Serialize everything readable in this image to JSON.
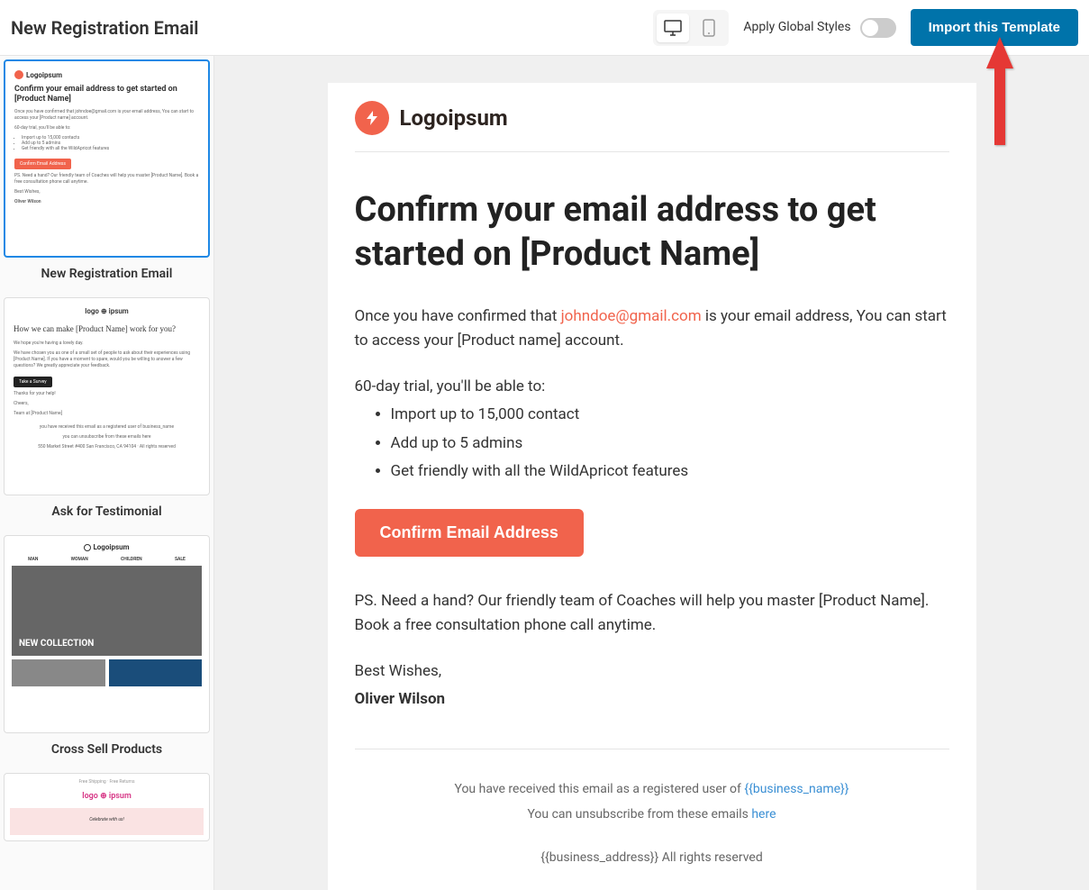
{
  "header": {
    "title": "New Registration Email",
    "globalStylesLabel": "Apply Global Styles",
    "importBtn": "Import this Template"
  },
  "sidebar": {
    "items": [
      {
        "label": "New Registration Email",
        "logo": "Logoipsum",
        "title": "Confirm your email address to get started on [Product Name]",
        "intro": "Once you have confirmed that johndoe@gmail.com is your email address, You can start to access your [Product name] account.",
        "trialLabel": "60-day trial, you'll be able to:",
        "bullets": [
          "Import up to 15,000 contacts",
          "Add up to 5 admins",
          "Get friendly with all the WildApricot features"
        ],
        "cta": "Confirm Email Address",
        "ps": "PS. Need a hand? Our friendly team of Coaches will help you master [Product Name]. Book a free consultation phone call anytime.",
        "sig1": "Best Wishes,",
        "sig2": "Oliver Wilson"
      },
      {
        "label": "Ask for Testimonial",
        "logo": "logo ⊕ ipsum",
        "title": "How we can make [Product Name] work for you?",
        "intro": "We hope you're having a lovely day.",
        "body": "We have chosen you as one of a small set of people to ask about their experiences using [Product Name]. If you have a moment to spare, would you be willing to answer a few questions? We greatly appreciate your feedback.",
        "cta": "Take a Survey",
        "sig1": "Thanks for your help!",
        "sig2": "Cheers,",
        "sig3": "Team at [Product Name]",
        "footer1": "you have received this email as a registered user of business_name",
        "footer2": "you can unsubscribe from these emails here",
        "footer3": "550 Market Street #400 San Francisco, CA 94104 · All rights reserved"
      },
      {
        "label": "Cross Sell Products",
        "logo": "Logoipsum",
        "nav": [
          "MAN",
          "WOMAN",
          "CHILDREN",
          "SALE"
        ],
        "heroText": "NEW COLLECTION"
      },
      {
        "label": "",
        "topBar": "Free Shipping · Free Returns",
        "logo": "logo ⊕ ipsum",
        "banner": "Celebrate with us!"
      }
    ]
  },
  "email": {
    "logo": "Logoipsum",
    "title": "Confirm your email address to get started on [Product Name]",
    "intro1": "Once you have confirmed that ",
    "introEmail": "johndoe@gmail.com",
    "intro2": " is your email address, You can start to access your [Product name] account.",
    "trialLabel": "60-day trial, you'll be able to:",
    "bullets": [
      "Import up to 15,000 contact",
      "Add up to 5 admins",
      "Get friendly with all the WildApricot features"
    ],
    "cta": "Confirm Email Address",
    "ps": "PS. Need a hand? Our friendly team of Coaches will help you master [Product Name]. Book a free consultation phone call anytime.",
    "sig1": "Best Wishes,",
    "sig2": "Oliver Wilson",
    "footer": {
      "line1a": "You have received this email as a registered user of ",
      "line1b": "{{business_name}}",
      "line2a": "You can unsubscribe from these emails ",
      "line2b": "here",
      "line3": "{{business_address}} All rights reserved"
    }
  }
}
